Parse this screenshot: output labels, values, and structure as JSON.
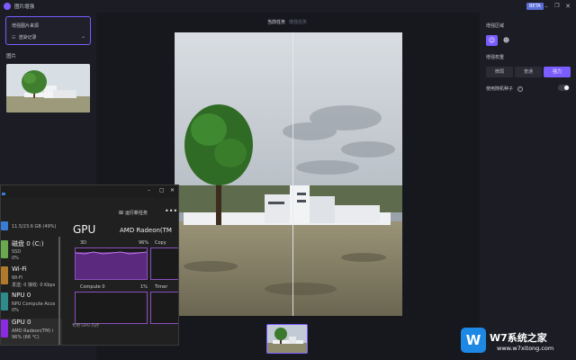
{
  "app": {
    "title": "图片增强",
    "badge": "BETA",
    "window_controls": [
      "minimize-icon",
      "maximize-icon",
      "close-icon"
    ]
  },
  "left_panel": {
    "source_title": "增强图片来源",
    "source_value": "渲染记录",
    "images_label": "图片"
  },
  "center": {
    "tabs": [
      "当前任务",
      "增强任务"
    ],
    "active_tab": 0
  },
  "right_panel": {
    "area_label": "增强区域",
    "area_options": [
      "person-icon",
      "portrait-icon"
    ],
    "strength_label": "增强权重",
    "strength_options": [
      "微弱",
      "普通",
      "强力"
    ],
    "strength_selected": 2,
    "random_seed_label": "使用随机种子",
    "random_seed_on": true
  },
  "task_manager": {
    "new_task_label": "运行新任务",
    "more_label": "•••",
    "items": [
      {
        "name": "",
        "sub1": "11.5/23.6 GB (49%)",
        "sub2": "",
        "color": "#3a7bd5"
      },
      {
        "name": "磁盘 0 (C:)",
        "sub1": "SSD",
        "sub2": "0%",
        "color": "#6aa84f"
      },
      {
        "name": "Wi-Fi",
        "sub1": "Wi-Fi",
        "sub2": "发送: 0 接收: 0 Kbps",
        "color": "#b07a2a"
      },
      {
        "name": "NPU 0",
        "sub1": "NPU Compute Acce",
        "sub2": "0%",
        "color": "#2e8b8b"
      },
      {
        "name": "GPU 0",
        "sub1": "AMD Radeon(TM) i",
        "sub2": "96% (66 °C)",
        "color": "#8a2be2"
      }
    ],
    "selected_index": 4,
    "heading": "GPU",
    "device": "AMD Radeon(TM",
    "graphs": [
      {
        "label": "3D",
        "value": "96%"
      },
      {
        "label": "Copy",
        "value": ""
      },
      {
        "label": "Compute 0",
        "value": "1%"
      },
      {
        "label": "Timer",
        "value": ""
      }
    ],
    "footer": "专用 GPU 内存"
  },
  "watermark": {
    "badge": "W",
    "title": "W7系统之家",
    "url": "www.w7xitong.com"
  },
  "colors": {
    "accent": "#7a5cff",
    "bg": "#1a1b22",
    "panel": "#1c1d24",
    "gpu": "#8a4fbf"
  }
}
